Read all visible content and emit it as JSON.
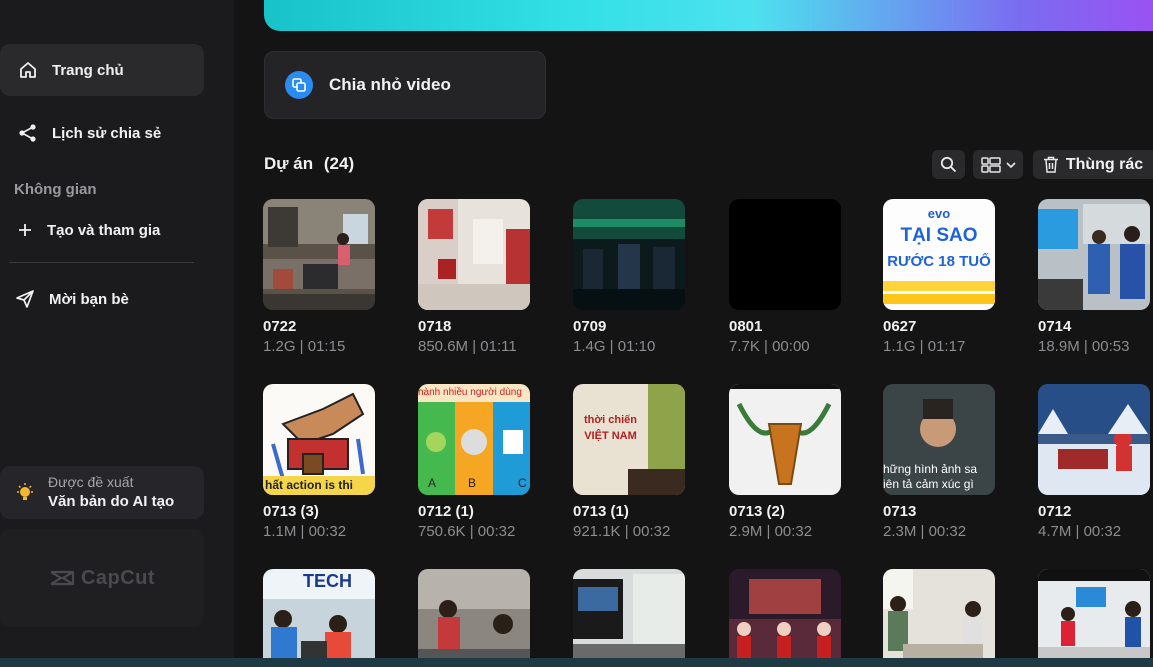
{
  "sidebar": {
    "home": "Trang chủ",
    "share_history": "Lịch sử chia sẻ",
    "space_label": "Không gian",
    "create_join": "Tạo và tham gia",
    "invite": "Mời bạn bè",
    "promo_subtitle": "Được đề xuất",
    "promo_title": "Văn bản do AI tạo",
    "logo": "CapCut"
  },
  "main": {
    "split_video": "Chia nhỏ video",
    "projects_label": "Dự án",
    "projects_count": "(24)",
    "trash": "Thùng rác"
  },
  "projects": [
    {
      "name": "0722",
      "meta": "1.2G | 01:15"
    },
    {
      "name": "0718",
      "meta": "850.6M | 01:11"
    },
    {
      "name": "0709",
      "meta": "1.4G | 01:10"
    },
    {
      "name": "0801",
      "meta": "7.7K | 00:00"
    },
    {
      "name": "0627",
      "meta": "1.1G | 01:17"
    },
    {
      "name": "0714",
      "meta": "18.9M | 00:53"
    },
    {
      "name": "0713 (3)",
      "meta": "1.1M | 00:32"
    },
    {
      "name": "0712 (1)",
      "meta": "750.6K | 00:32"
    },
    {
      "name": "0713 (1)",
      "meta": "921.1K | 00:32"
    },
    {
      "name": "0713 (2)",
      "meta": "2.9M | 00:32"
    },
    {
      "name": "0713",
      "meta": "2.3M | 00:32"
    },
    {
      "name": "0712",
      "meta": "4.7M | 00:32"
    },
    {
      "name": "",
      "meta": ""
    },
    {
      "name": "",
      "meta": ""
    },
    {
      "name": "",
      "meta": ""
    },
    {
      "name": "",
      "meta": ""
    },
    {
      "name": "",
      "meta": ""
    },
    {
      "name": "",
      "meta": ""
    }
  ],
  "thumb_text": {
    "t0627_a": "TẠI SAO",
    "t0627_b": "RƯỚC 18 TUỔ",
    "t0627_logo": "evo",
    "t0712_1_top": "hành nhiều người dùng",
    "t0713_1_a": "thời chiến",
    "t0713_1_b": "VIỆT NAM",
    "t0713_a": "hững hình ảnh sa",
    "t0713_b": "iên tả cảm xúc gì",
    "t0713_3": "hất action is thi",
    "tech": "TECH"
  }
}
